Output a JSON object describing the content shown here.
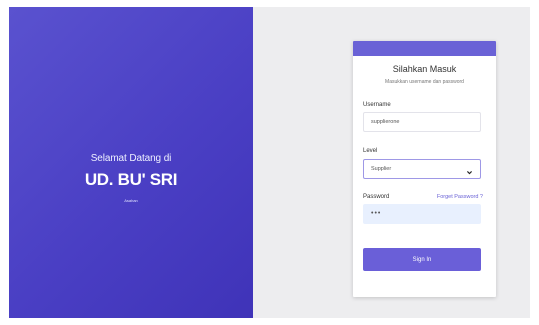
{
  "hero": {
    "welcome": "Selamat Datang di",
    "brand": "UD. BU' SRI",
    "location": "Asahan"
  },
  "login": {
    "title": "Silahkan Masuk",
    "subtitle": "Masukkan username dan password",
    "username_label": "Username",
    "username_value": "supplierone",
    "level_label": "Level",
    "level_value": "Supplier",
    "password_label": "Password",
    "forget_password": "Forget Password ?",
    "password_value": "•••",
    "signin_label": "Sign In"
  },
  "colors": {
    "hero_gradient_start": "#5a52cf",
    "hero_gradient_end": "#3f33b8",
    "accent": "#6a62d6",
    "background": "#ededef"
  },
  "icons": {
    "level_dropdown": "chevron-down-icon"
  }
}
